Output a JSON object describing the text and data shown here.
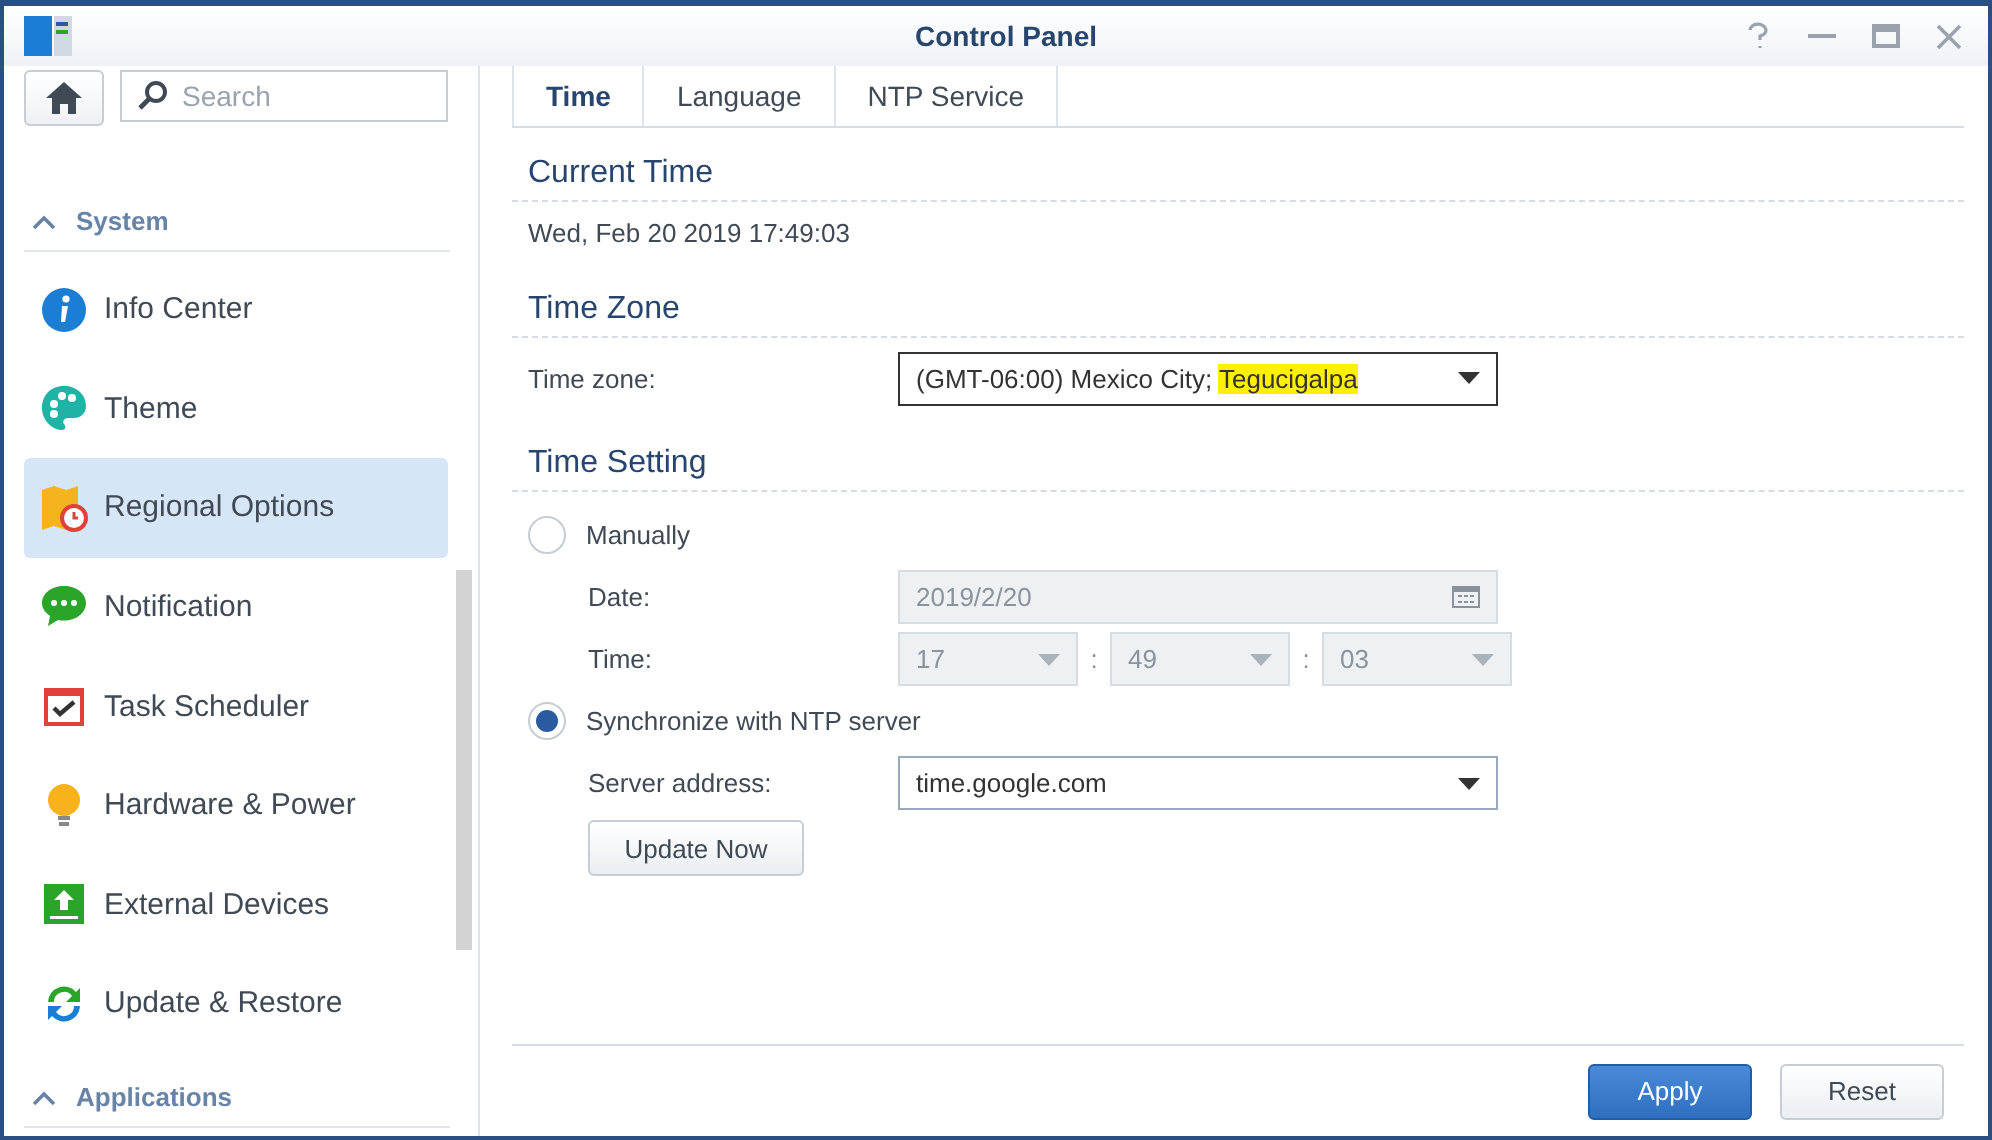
{
  "window": {
    "title": "Control Panel"
  },
  "sidebar": {
    "search": {
      "placeholder": "Search"
    },
    "sections": [
      {
        "kind": "header",
        "label": "System",
        "expanded": true
      },
      {
        "kind": "item",
        "label": "Info Center",
        "selected": false
      },
      {
        "kind": "item",
        "label": "Theme",
        "selected": false
      },
      {
        "kind": "item",
        "label": "Regional Options",
        "selected": true
      },
      {
        "kind": "item",
        "label": "Notification",
        "selected": false
      },
      {
        "kind": "item",
        "label": "Task Scheduler",
        "selected": false
      },
      {
        "kind": "item",
        "label": "Hardware & Power",
        "selected": false
      },
      {
        "kind": "item",
        "label": "External Devices",
        "selected": false
      },
      {
        "kind": "item",
        "label": "Update & Restore",
        "selected": false
      },
      {
        "kind": "header",
        "label": "Applications",
        "expanded": true
      }
    ]
  },
  "tabs": [
    {
      "label": "Time",
      "selected": true
    },
    {
      "label": "Language",
      "selected": false
    },
    {
      "label": "NTP Service",
      "selected": false
    }
  ],
  "current_time": {
    "heading": "Current Time",
    "value": "Wed, Feb 20 2019 17:49:03"
  },
  "time_zone": {
    "heading": "Time Zone",
    "label": "Time zone:",
    "value": "(GMT-06:00) Mexico City;",
    "highlighted": "Tegucigalpa"
  },
  "time_setting": {
    "heading": "Time Setting",
    "manual": {
      "label": "Manually",
      "selected": false,
      "date_label": "Date:",
      "date": "2019/2/20",
      "time_label": "Time:",
      "hour": "17",
      "minute": "49",
      "second": "03",
      "separator": ":",
      "disabled": true
    },
    "ntp": {
      "label": "Synchronize with NTP server",
      "selected": true,
      "server_label": "Server address:",
      "server": "time.google.com",
      "update_button": "Update Now"
    }
  },
  "footer": {
    "buttons": [
      {
        "label": "Apply",
        "kind": "primary"
      },
      {
        "label": "Reset",
        "kind": "secondary"
      }
    ]
  }
}
